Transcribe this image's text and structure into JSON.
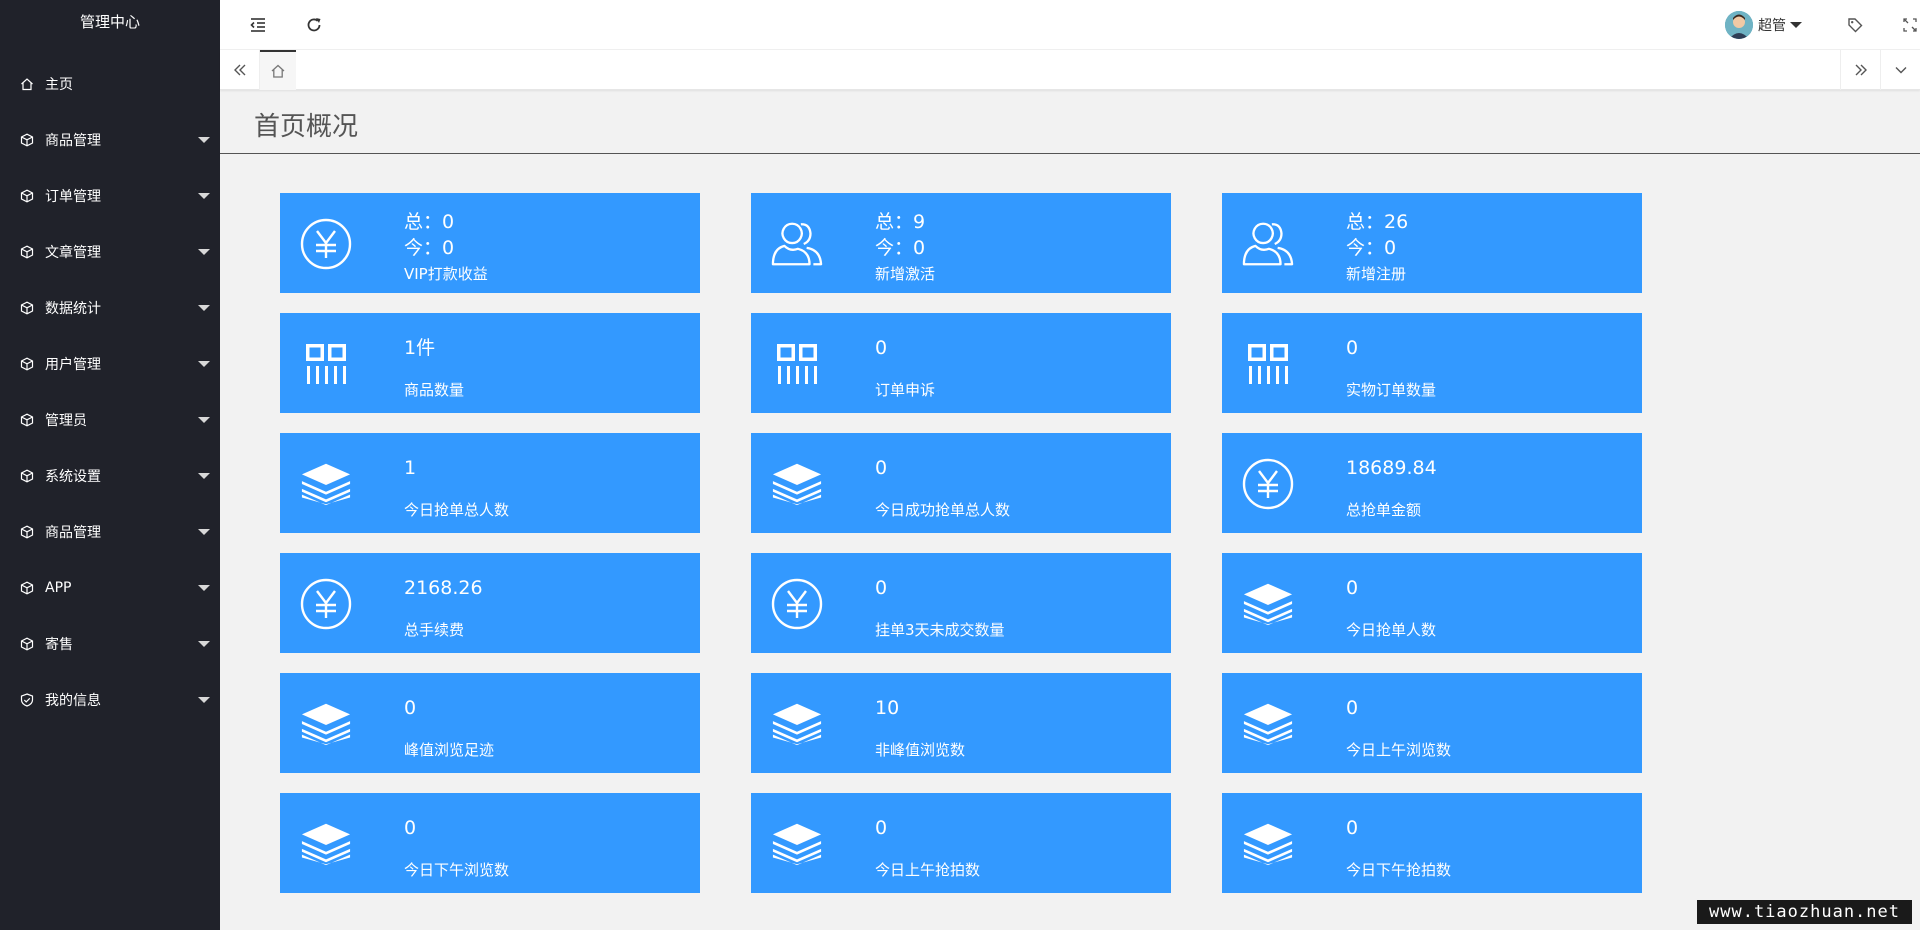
{
  "sidebar": {
    "title": "管理中心",
    "items": [
      {
        "label": "主页",
        "icon": "home-icon",
        "expandable": false
      },
      {
        "label": "商品管理",
        "icon": "cube-icon",
        "expandable": true
      },
      {
        "label": "订单管理",
        "icon": "cube-icon",
        "expandable": true
      },
      {
        "label": "文章管理",
        "icon": "cube-icon",
        "expandable": true
      },
      {
        "label": "数据统计",
        "icon": "cube-icon",
        "expandable": true
      },
      {
        "label": "用户管理",
        "icon": "cube-icon",
        "expandable": true
      },
      {
        "label": "管理员",
        "icon": "cube-icon",
        "expandable": true
      },
      {
        "label": "系统设置",
        "icon": "cube-icon",
        "expandable": true
      },
      {
        "label": "商品管理",
        "icon": "cube-icon",
        "expandable": true
      },
      {
        "label": "APP",
        "icon": "cube-icon",
        "expandable": true
      },
      {
        "label": "寄售",
        "icon": "cube-icon",
        "expandable": true
      },
      {
        "label": "我的信息",
        "icon": "shield-check-icon",
        "expandable": true
      }
    ]
  },
  "header": {
    "user_name": "超管"
  },
  "page": {
    "title": "首页概况"
  },
  "cards": [
    {
      "icon": "yen-icon",
      "total_label": "总：",
      "total": "0",
      "today_label": "今：",
      "today": "0",
      "label": "VIP打款收益"
    },
    {
      "icon": "users-icon",
      "total_label": "总：",
      "total": "9",
      "today_label": "今：",
      "today": "0",
      "label": "新增激活"
    },
    {
      "icon": "users-icon",
      "total_label": "总：",
      "total": "26",
      "today_label": "今：",
      "today": "0",
      "label": "新增注册"
    },
    {
      "icon": "columns-icon",
      "value": "1件",
      "label": "商品数量"
    },
    {
      "icon": "columns-icon",
      "value": "0",
      "label": "订单申诉"
    },
    {
      "icon": "columns-icon",
      "value": "0",
      "label": "实物订单数量"
    },
    {
      "icon": "layers-icon",
      "value": "1",
      "label": "今日抢单总人数"
    },
    {
      "icon": "layers-icon",
      "value": "0",
      "label": "今日成功抢单总人数"
    },
    {
      "icon": "yen-icon",
      "value": "18689.84",
      "label": "总抢单金额"
    },
    {
      "icon": "yen-icon",
      "value": "2168.26",
      "label": "总手续费"
    },
    {
      "icon": "yen-icon",
      "value": "0",
      "label": "挂单3天未成交数量"
    },
    {
      "icon": "layers-icon",
      "value": "0",
      "label": "今日抢单人数"
    },
    {
      "icon": "layers-icon",
      "value": "0",
      "label": "峰值浏览足迹"
    },
    {
      "icon": "layers-icon",
      "value": "10",
      "label": "非峰值浏览数"
    },
    {
      "icon": "layers-icon",
      "value": "0",
      "label": "今日上午浏览数"
    },
    {
      "icon": "layers-icon",
      "value": "0",
      "label": "今日下午浏览数"
    },
    {
      "icon": "layers-icon",
      "value": "0",
      "label": "今日上午抢拍数"
    },
    {
      "icon": "layers-icon",
      "value": "0",
      "label": "今日下午抢拍数"
    }
  ],
  "watermark": "www.tiaozhuan.net",
  "colors": {
    "sidebar_bg": "#20222a",
    "card_bg": "#3399ff",
    "content_bg": "#f2f2f2"
  }
}
